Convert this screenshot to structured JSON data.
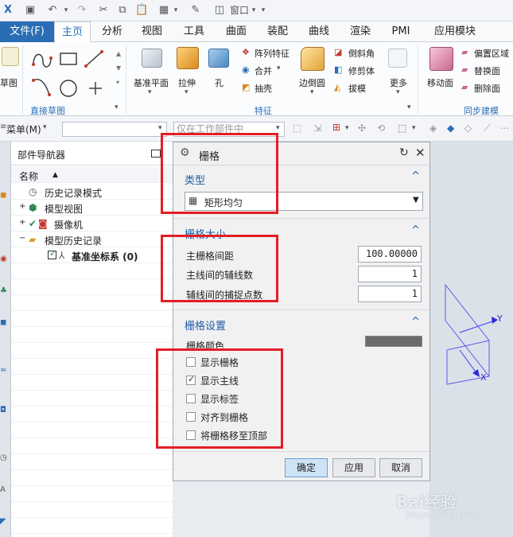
{
  "quick_access": {
    "window_label": "窗口"
  },
  "tabs": [
    {
      "label": "文件(F)"
    },
    {
      "label": "主页"
    },
    {
      "label": "分析"
    },
    {
      "label": "视图"
    },
    {
      "label": "工具"
    },
    {
      "label": "曲面"
    },
    {
      "label": "装配"
    },
    {
      "label": "曲线"
    },
    {
      "label": "渲染"
    },
    {
      "label": "PMI"
    },
    {
      "label": "应用模块"
    }
  ],
  "ribbon": {
    "sketch_label": "草图",
    "direct_sketch_group": "直接草图",
    "datum_plane": "基准平面",
    "extrude": "拉伸",
    "hole": "孔",
    "array_feature": "阵列特征",
    "unite": "合并",
    "shell": "抽壳",
    "edge_blend": "边倒圆",
    "chamfer": "倒斜角",
    "trim_body": "修剪体",
    "draft": "拔模",
    "more": "更多",
    "feature_group": "特征",
    "move_face": "移动面",
    "offset_region": "偏置区域",
    "replace_face": "替换面",
    "delete_face": "删除面",
    "sync_group": "同步建模"
  },
  "command_bar": {
    "menu_label": "菜单(M)",
    "filter_placeholder": "仅在工作部件中"
  },
  "navigator": {
    "title": "部件导航器",
    "column_name": "名称",
    "items": [
      {
        "label": "历史记录模式"
      },
      {
        "label": "模型视图"
      },
      {
        "label": "摄像机"
      },
      {
        "label": "模型历史记录"
      },
      {
        "label": "基准坐标系 (0)"
      }
    ]
  },
  "dialog": {
    "title": "栅格",
    "type_section": "类型",
    "type_value": "矩形均匀",
    "size_section": "栅格大小",
    "main_spacing_label": "主栅格间距",
    "main_spacing_value": "100.00000",
    "aux_lines_label": "主线间的辅线数",
    "aux_lines_value": "1",
    "snap_points_label": "辅线间的捕捉点数",
    "snap_points_value": "1",
    "settings_section": "栅格设置",
    "color_label": "栅格颜色",
    "grid_color": "#6b6b6b",
    "options": [
      {
        "label": "显示栅格",
        "checked": false
      },
      {
        "label": "显示主线",
        "checked": true
      },
      {
        "label": "显示标签",
        "checked": false
      },
      {
        "label": "对齐到栅格",
        "checked": false
      },
      {
        "label": "将栅格移至顶部",
        "checked": false
      }
    ],
    "ok": "确定",
    "apply": "应用",
    "cancel": "取消"
  },
  "axes": {
    "y": "Y",
    "x": "X"
  },
  "watermark": {
    "brand": "Bai经验",
    "url": "jingyan.baidu.com"
  },
  "colors": {
    "accent": "#2a6db5",
    "highlight": "#e41e25"
  }
}
